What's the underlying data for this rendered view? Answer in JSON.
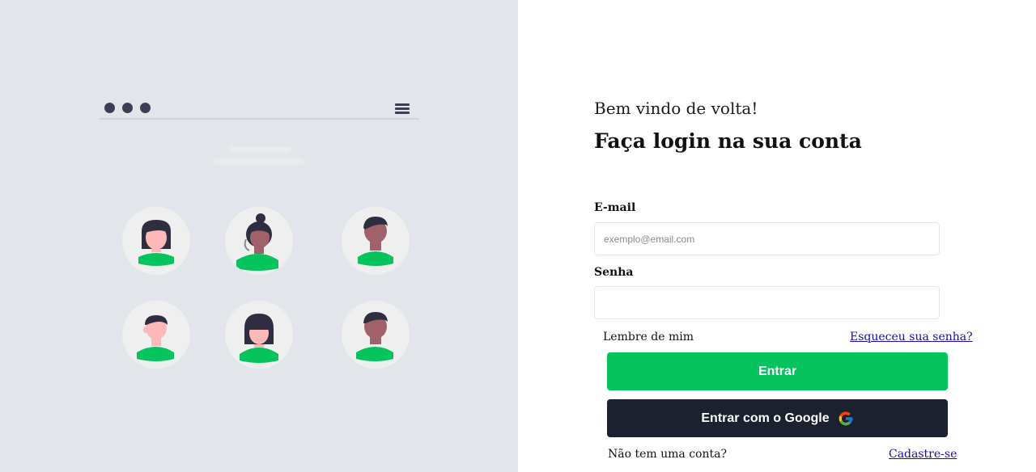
{
  "login": {
    "welcome_text": "Bem vindo de volta!",
    "title": "Faça login na sua conta",
    "email_label": "E-mail",
    "email_placeholder": "exemplo@email.com",
    "email_value": "",
    "password_label": "Senha",
    "password_value": "",
    "remember_label": "Lembre de mim",
    "forgot_link": "Esqueceu sua senha?",
    "submit_label": "Entrar",
    "google_label": "Entrar com o Google",
    "no_account_text": "Não tem uma conta?",
    "signup_link": "Cadastre-se"
  },
  "illustration": {
    "avatars": [
      "avatar-woman-short-hair",
      "avatar-woman-bun",
      "avatar-man-dark-skin",
      "avatar-man-light-skin",
      "avatar-woman-bangs",
      "avatar-man-dark-skin-2"
    ]
  },
  "colors": {
    "left_panel_bg": "#e2e6ea",
    "primary_green": "#05c35d",
    "google_button_bg": "#1c2130",
    "link_blue": "#1a0dab",
    "illustration_dark": "#3f3d56"
  }
}
